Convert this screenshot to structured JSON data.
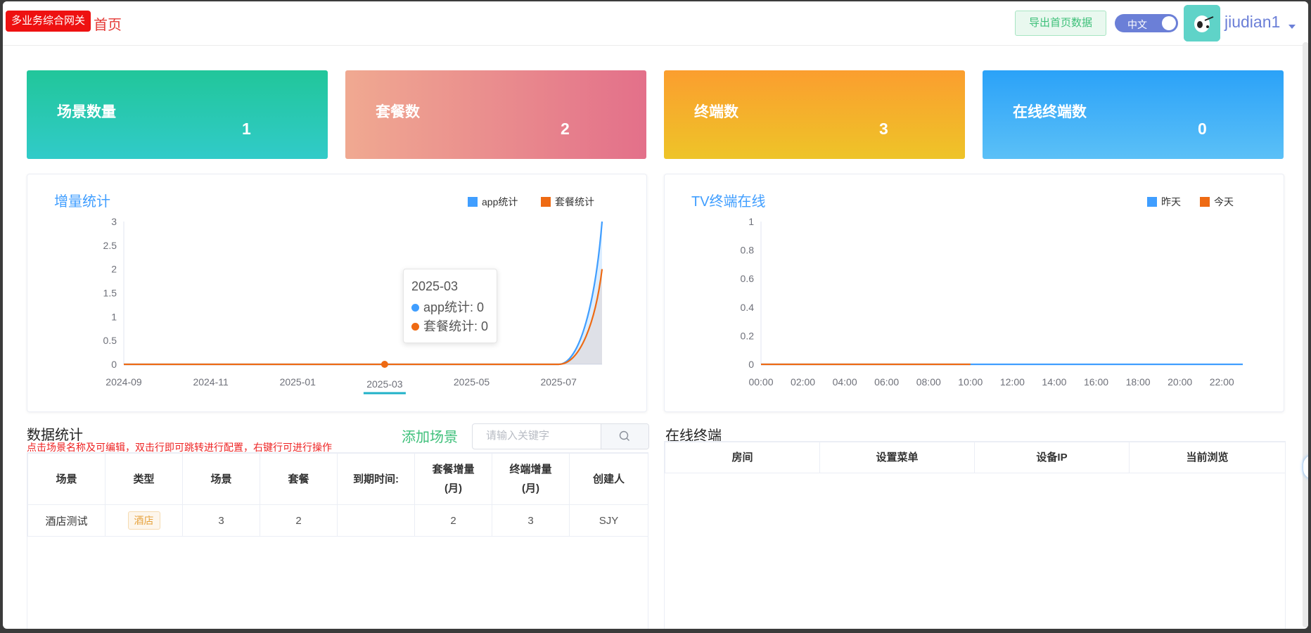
{
  "header": {
    "brand": "多业务综合网关",
    "home": "首页",
    "export_label": "导出首页数据",
    "lang_label": "中文",
    "username": "jiudian1"
  },
  "stats": [
    {
      "label": "场景数量",
      "value": "1"
    },
    {
      "label": "套餐数",
      "value": "2"
    },
    {
      "label": "终端数",
      "value": "3"
    },
    {
      "label": "在线终端数",
      "value": "0"
    }
  ],
  "colors": {
    "blue_series": "#409eff",
    "orange_series": "#ee6a13",
    "accent_green": "#3ec07a",
    "title_blue": "#409eff"
  },
  "chart_data": [
    {
      "type": "line",
      "title": "增量统计",
      "legend_position": "top-right",
      "x": [
        "2024-09",
        "2024-10",
        "2024-11",
        "2024-12",
        "2025-01",
        "2025-02",
        "2025-03",
        "2025-04",
        "2025-05",
        "2025-06",
        "2025-07",
        "2025-08"
      ],
      "xtick_labels": [
        "2024-09",
        "2024-11",
        "2025-01",
        "2025-03",
        "2025-05",
        "2025-07"
      ],
      "highlighted_tick": "2025-03",
      "series": [
        {
          "name": "app统计",
          "values": [
            0,
            0,
            0,
            0,
            0,
            0,
            0,
            0,
            0,
            0,
            0,
            3
          ]
        },
        {
          "name": "套餐统计",
          "values": [
            0,
            0,
            0,
            0,
            0,
            0,
            0,
            0,
            0,
            0,
            0,
            2
          ]
        }
      ],
      "ylim": [
        0,
        3
      ],
      "yticks": [
        "0",
        "0.5",
        "1",
        "1.5",
        "2",
        "2.5",
        "3"
      ],
      "tooltip": {
        "title": "2025-03",
        "rows": [
          "app统计: 0",
          "套餐统计: 0"
        ]
      }
    },
    {
      "type": "line",
      "title": "TV终端在线",
      "legend_position": "top-right",
      "x": [
        "00:00",
        "01:00",
        "02:00",
        "03:00",
        "04:00",
        "05:00",
        "06:00",
        "07:00",
        "08:00",
        "09:00",
        "10:00",
        "11:00",
        "12:00",
        "13:00",
        "14:00",
        "15:00",
        "16:00",
        "17:00",
        "18:00",
        "19:00",
        "20:00",
        "21:00",
        "22:00",
        "23:00"
      ],
      "xtick_labels": [
        "00:00",
        "02:00",
        "04:00",
        "06:00",
        "08:00",
        "10:00",
        "12:00",
        "14:00",
        "16:00",
        "18:00",
        "20:00",
        "22:00"
      ],
      "series": [
        {
          "name": "昨天",
          "values": [
            0,
            0,
            0,
            0,
            0,
            0,
            0,
            0,
            0,
            0,
            0,
            0,
            0,
            0,
            0,
            0,
            0,
            0,
            0,
            0,
            0,
            0,
            0,
            0
          ]
        },
        {
          "name": "今天",
          "values": [
            0,
            0,
            0,
            0,
            0,
            0,
            0,
            0,
            0,
            0,
            0
          ]
        }
      ],
      "ylim": [
        0,
        1
      ],
      "yticks": [
        "0",
        "0.2",
        "0.4",
        "0.6",
        "0.8",
        "1"
      ]
    }
  ],
  "data_stats": {
    "title": "数据统计",
    "hint": "点击场景名称及可编辑，双击行即可跳转进行配置，右键行可进行操作",
    "add_label": "添加场景",
    "search_placeholder": "请输入关键字",
    "columns": [
      "场景",
      "类型",
      "场景",
      "套餐",
      "到期时间:",
      "套餐增量(月)",
      "终端增量(月)",
      "创建人"
    ],
    "rows": [
      {
        "scene": "酒店测试",
        "type": "酒店",
        "scene_count": "3",
        "package": "2",
        "expire": "",
        "package_inc": "2",
        "terminal_inc": "3",
        "creator": "SJY"
      }
    ]
  },
  "online": {
    "title": "在线终端",
    "columns": [
      "房间",
      "设置菜单",
      "设备IP",
      "当前浏览"
    ]
  }
}
